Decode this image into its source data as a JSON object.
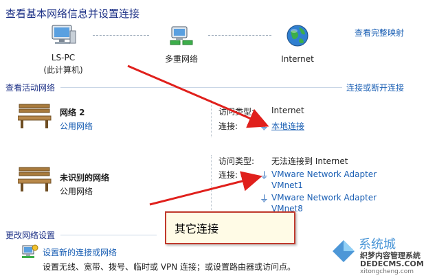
{
  "title": "查看基本网络信息并设置连接",
  "map": {
    "view_full_map": "查看完整映射",
    "computer": {
      "name": "LS-PC",
      "sub": "(此计算机)"
    },
    "multi": {
      "name": "多重网络"
    },
    "internet": {
      "name": "Internet"
    }
  },
  "active": {
    "heading": "查看活动网络",
    "connect_link": "连接或断开连接",
    "networks": [
      {
        "name": "网络  2",
        "type_link": "公用网络",
        "access_label": "访问类型:",
        "access_value": "Internet",
        "conn_label": "连接:",
        "connections": [
          "本地连接"
        ]
      },
      {
        "name": "未识别的网络",
        "type_text": "公用网络",
        "access_label": "访问类型:",
        "access_value": "无法连接到 Internet",
        "conn_label": "连接:",
        "connections": [
          "VMware Network Adapter VMnet1",
          "VMware Network Adapter VMnet8"
        ],
        "connections_lines": [
          [
            "VMware Network Adapter",
            "VMnet1"
          ],
          [
            "VMware Network Adapter",
            "VMnet8"
          ]
        ]
      }
    ]
  },
  "change": {
    "heading": "更改网络设置",
    "new_conn_link": "设置新的连接或网络",
    "new_conn_desc": "设置无线、宽带、拨号、临时或 VPN 连接；或设置路由器或访问点。"
  },
  "annotation": {
    "text": "其它连接"
  },
  "watermark": {
    "line1": "系统城",
    "line2": "织梦内容管理系统",
    "line3": "DEDECMS.COM",
    "line4": "xitongcheng.com"
  },
  "colors": {
    "link": "#1a5fb4",
    "heading": "#1e3287",
    "arrow": "#e0201c"
  }
}
